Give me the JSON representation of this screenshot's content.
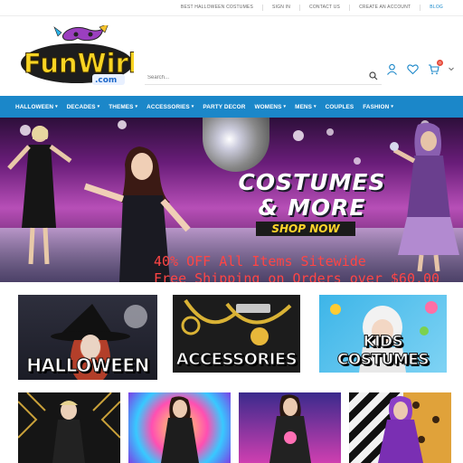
{
  "topbar": {
    "links": [
      "BEST HALLOWEEN COSTUMES",
      "SIGN IN",
      "CONTACT US",
      "CREATE AN ACCOUNT",
      "BLOG"
    ]
  },
  "header": {
    "logo_text": "FunWirks",
    "logo_suffix": ".com",
    "search_placeholder": "Search...",
    "cart_count": "0"
  },
  "nav": {
    "items": [
      {
        "label": "HALLOWEEN",
        "has_dropdown": true
      },
      {
        "label": "DECADES",
        "has_dropdown": true
      },
      {
        "label": "THEMES",
        "has_dropdown": true
      },
      {
        "label": "ACCESSORIES",
        "has_dropdown": true
      },
      {
        "label": "PARTY DECOR",
        "has_dropdown": false
      },
      {
        "label": "WOMENS",
        "has_dropdown": true
      },
      {
        "label": "MENS",
        "has_dropdown": true
      },
      {
        "label": "COUPLES",
        "has_dropdown": false
      },
      {
        "label": "FASHION",
        "has_dropdown": true
      }
    ]
  },
  "hero": {
    "headline_1": "COSTUMES",
    "headline_2": "& MORE",
    "cta": "SHOP NOW",
    "promo_1": "40% OFF All Items Sitewide",
    "promo_2": "Free Shipping on Orders over $60.00"
  },
  "categories": [
    {
      "label": "HALLOWEEN"
    },
    {
      "label": "ACCESSORIES"
    },
    {
      "label": "KIDS COSTUMES"
    }
  ],
  "colors": {
    "nav_bg": "#1b87c9",
    "blog_link": "#1a8acb",
    "promo_text": "#ff4545",
    "cta_text": "#ffd42a",
    "cart_badge": "#e74c3c"
  }
}
